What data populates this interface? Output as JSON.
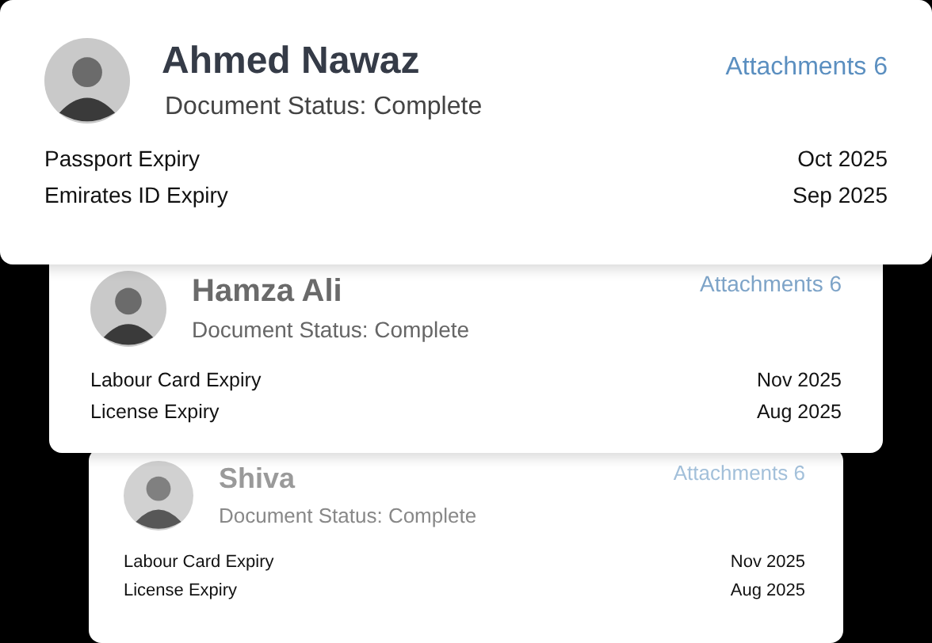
{
  "cards": [
    {
      "name": "Ahmed Nawaz",
      "status": "Document Status: Complete",
      "attachments": "Attachments 6",
      "rows": [
        {
          "label": "Passport Expiry",
          "value": "Oct 2025"
        },
        {
          "label": "Emirates ID Expiry",
          "value": "Sep 2025"
        }
      ]
    },
    {
      "name": "Hamza Ali",
      "status": "Document Status: Complete",
      "attachments": "Attachments 6",
      "rows": [
        {
          "label": "Labour Card Expiry",
          "value": "Nov 2025"
        },
        {
          "label": "License Expiry",
          "value": "Aug 2025"
        }
      ]
    },
    {
      "name": "Shiva",
      "status": "Document Status: Complete",
      "attachments": "Attachments 6",
      "rows": [
        {
          "label": "Labour Card Expiry",
          "value": "Nov 2025"
        },
        {
          "label": "License Expiry",
          "value": "Aug 2025"
        }
      ]
    }
  ]
}
